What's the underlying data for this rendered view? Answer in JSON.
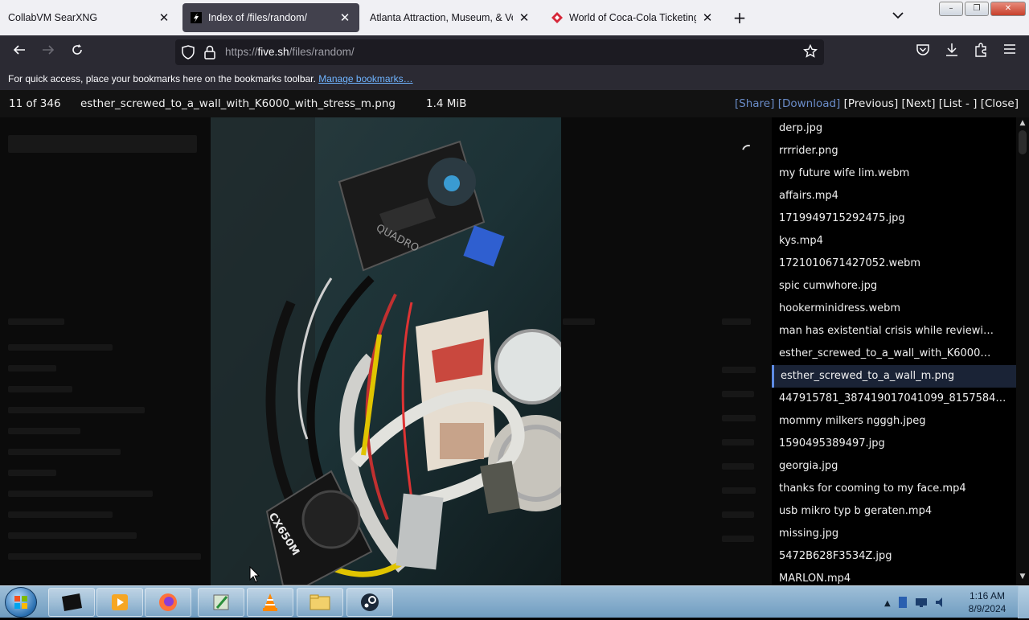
{
  "tabs": [
    {
      "title": "CollabVM SearXNG",
      "active": false
    },
    {
      "title": "Index of /files/random/",
      "active": true
    },
    {
      "title": "Atlanta Attraction, Museum, & Ven",
      "active": false
    },
    {
      "title": "World of Coca-Cola Ticketing S",
      "active": false
    }
  ],
  "navbar": {
    "url_prefix": "https://",
    "url_host": "five.sh",
    "url_path": "/files/random/"
  },
  "bookmarks": {
    "message": "For quick access, place your bookmarks here on the bookmarks toolbar.",
    "manage_link": "Manage bookmarks…"
  },
  "viewer": {
    "counter": "11 of 346",
    "filename": "esther_screwed_to_a_wall_with_K6000_with_stress_m.png",
    "filesize": "1.4 MiB",
    "share": "[Share]",
    "download": "[Download]",
    "previous": "[Previous]",
    "next": "[Next]",
    "list": "[List - ]",
    "close": "[Close]"
  },
  "files": [
    "derp.jpg",
    "rrrrider.png",
    "my future wife lim.webm",
    "affairs.mp4",
    "1719949715292475.jpg",
    "kys.mp4",
    "1721010671427052.webm",
    "spic cumwhore.jpg",
    "hookerminidress.webm",
    "man has existential crisis while reviewi…",
    "esther_screwed_to_a_wall_with_K6000…",
    "esther_screwed_to_a_wall_m.png",
    "447915781_387419017041099_8157584…",
    "mommy milkers ngggh.jpeg",
    "1590495389497.jpg",
    "georgia.jpg",
    "thanks for cooming to my face.mp4",
    "usb mikro typ b geraten.mp4",
    "missing.jpg",
    "5472B628F3534Z.jpg",
    "MARLON.mp4"
  ],
  "active_file_index": 11,
  "photo_labels": {
    "gpu": "QUADRO",
    "psu": "CX650M"
  },
  "clock": {
    "time": "1:16 AM",
    "date": "8/9/2024"
  },
  "colors": {
    "accent_blue": "#6a8cc8",
    "active_row": "#1a2336",
    "browser_dark": "#2b2a33"
  }
}
